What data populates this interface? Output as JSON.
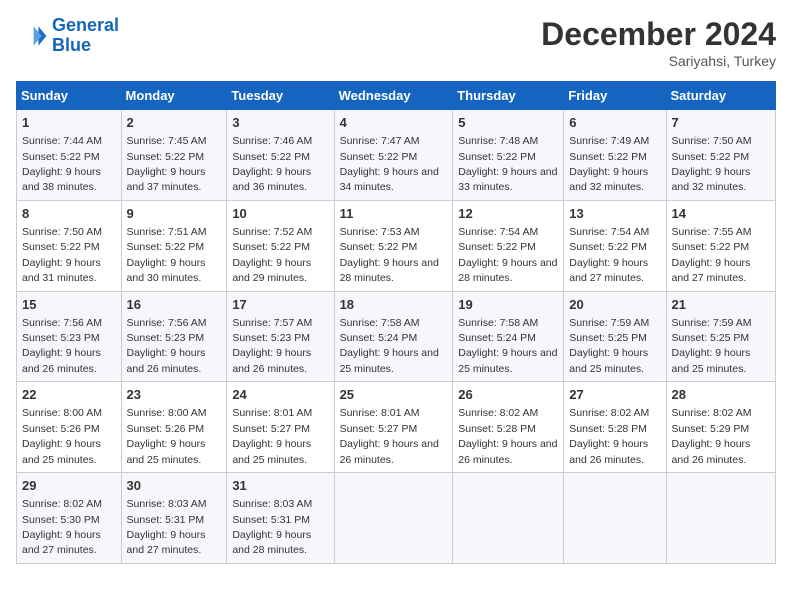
{
  "logo": {
    "line1": "General",
    "line2": "Blue"
  },
  "title": "December 2024",
  "subtitle": "Sariyahsi, Turkey",
  "days_of_week": [
    "Sunday",
    "Monday",
    "Tuesday",
    "Wednesday",
    "Thursday",
    "Friday",
    "Saturday"
  ],
  "weeks": [
    [
      {
        "day": "1",
        "sunrise": "7:44 AM",
        "sunset": "5:22 PM",
        "daylight": "9 hours and 38 minutes."
      },
      {
        "day": "2",
        "sunrise": "7:45 AM",
        "sunset": "5:22 PM",
        "daylight": "9 hours and 37 minutes."
      },
      {
        "day": "3",
        "sunrise": "7:46 AM",
        "sunset": "5:22 PM",
        "daylight": "9 hours and 36 minutes."
      },
      {
        "day": "4",
        "sunrise": "7:47 AM",
        "sunset": "5:22 PM",
        "daylight": "9 hours and 34 minutes."
      },
      {
        "day": "5",
        "sunrise": "7:48 AM",
        "sunset": "5:22 PM",
        "daylight": "9 hours and 33 minutes."
      },
      {
        "day": "6",
        "sunrise": "7:49 AM",
        "sunset": "5:22 PM",
        "daylight": "9 hours and 32 minutes."
      },
      {
        "day": "7",
        "sunrise": "7:50 AM",
        "sunset": "5:22 PM",
        "daylight": "9 hours and 32 minutes."
      }
    ],
    [
      {
        "day": "8",
        "sunrise": "7:50 AM",
        "sunset": "5:22 PM",
        "daylight": "9 hours and 31 minutes."
      },
      {
        "day": "9",
        "sunrise": "7:51 AM",
        "sunset": "5:22 PM",
        "daylight": "9 hours and 30 minutes."
      },
      {
        "day": "10",
        "sunrise": "7:52 AM",
        "sunset": "5:22 PM",
        "daylight": "9 hours and 29 minutes."
      },
      {
        "day": "11",
        "sunrise": "7:53 AM",
        "sunset": "5:22 PM",
        "daylight": "9 hours and 28 minutes."
      },
      {
        "day": "12",
        "sunrise": "7:54 AM",
        "sunset": "5:22 PM",
        "daylight": "9 hours and 28 minutes."
      },
      {
        "day": "13",
        "sunrise": "7:54 AM",
        "sunset": "5:22 PM",
        "daylight": "9 hours and 27 minutes."
      },
      {
        "day": "14",
        "sunrise": "7:55 AM",
        "sunset": "5:22 PM",
        "daylight": "9 hours and 27 minutes."
      }
    ],
    [
      {
        "day": "15",
        "sunrise": "7:56 AM",
        "sunset": "5:23 PM",
        "daylight": "9 hours and 26 minutes."
      },
      {
        "day": "16",
        "sunrise": "7:56 AM",
        "sunset": "5:23 PM",
        "daylight": "9 hours and 26 minutes."
      },
      {
        "day": "17",
        "sunrise": "7:57 AM",
        "sunset": "5:23 PM",
        "daylight": "9 hours and 26 minutes."
      },
      {
        "day": "18",
        "sunrise": "7:58 AM",
        "sunset": "5:24 PM",
        "daylight": "9 hours and 25 minutes."
      },
      {
        "day": "19",
        "sunrise": "7:58 AM",
        "sunset": "5:24 PM",
        "daylight": "9 hours and 25 minutes."
      },
      {
        "day": "20",
        "sunrise": "7:59 AM",
        "sunset": "5:25 PM",
        "daylight": "9 hours and 25 minutes."
      },
      {
        "day": "21",
        "sunrise": "7:59 AM",
        "sunset": "5:25 PM",
        "daylight": "9 hours and 25 minutes."
      }
    ],
    [
      {
        "day": "22",
        "sunrise": "8:00 AM",
        "sunset": "5:26 PM",
        "daylight": "9 hours and 25 minutes."
      },
      {
        "day": "23",
        "sunrise": "8:00 AM",
        "sunset": "5:26 PM",
        "daylight": "9 hours and 25 minutes."
      },
      {
        "day": "24",
        "sunrise": "8:01 AM",
        "sunset": "5:27 PM",
        "daylight": "9 hours and 25 minutes."
      },
      {
        "day": "25",
        "sunrise": "8:01 AM",
        "sunset": "5:27 PM",
        "daylight": "9 hours and 26 minutes."
      },
      {
        "day": "26",
        "sunrise": "8:02 AM",
        "sunset": "5:28 PM",
        "daylight": "9 hours and 26 minutes."
      },
      {
        "day": "27",
        "sunrise": "8:02 AM",
        "sunset": "5:28 PM",
        "daylight": "9 hours and 26 minutes."
      },
      {
        "day": "28",
        "sunrise": "8:02 AM",
        "sunset": "5:29 PM",
        "daylight": "9 hours and 26 minutes."
      }
    ],
    [
      {
        "day": "29",
        "sunrise": "8:02 AM",
        "sunset": "5:30 PM",
        "daylight": "9 hours and 27 minutes."
      },
      {
        "day": "30",
        "sunrise": "8:03 AM",
        "sunset": "5:31 PM",
        "daylight": "9 hours and 27 minutes."
      },
      {
        "day": "31",
        "sunrise": "8:03 AM",
        "sunset": "5:31 PM",
        "daylight": "9 hours and 28 minutes."
      },
      null,
      null,
      null,
      null
    ]
  ]
}
